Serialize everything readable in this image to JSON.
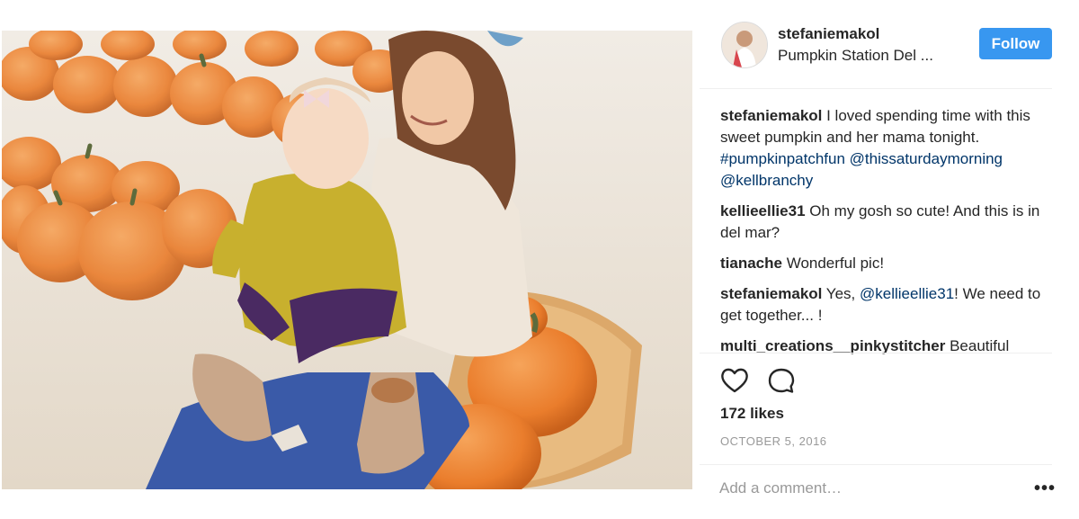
{
  "post": {
    "username": "stefaniemakol",
    "location": "Pumpkin Station Del ...",
    "follow_label": "Follow",
    "accent_color": "#3897f0",
    "photo_description_icon": "photo"
  },
  "comments": [
    {
      "user": "stefaniemakol",
      "parts": [
        {
          "text": " I loved spending time with this sweet pumpkin and her mama tonight. ",
          "link": false
        },
        {
          "text": "#pumpkinpatchfun",
          "link": true
        },
        {
          "text": " ",
          "link": false
        },
        {
          "text": "@thissaturdaymorning",
          "link": true
        },
        {
          "text": " ",
          "link": false
        },
        {
          "text": "@kellbranchy",
          "link": true
        }
      ]
    },
    {
      "user": "kellieellie31",
      "parts": [
        {
          "text": " Oh my gosh so cute! And this is in del mar?",
          "link": false
        }
      ]
    },
    {
      "user": "tianache",
      "parts": [
        {
          "text": " Wonderful pic!",
          "link": false
        }
      ]
    },
    {
      "user": "stefaniemakol",
      "parts": [
        {
          "text": " Yes, ",
          "link": false
        },
        {
          "text": "@kellieellie31",
          "link": true
        },
        {
          "text": "! We need to get together... !",
          "link": false
        }
      ]
    },
    {
      "user": "multi_creations__pinkystitcher",
      "parts": [
        {
          "text": " Beautiful",
          "link": false
        }
      ]
    }
  ],
  "stats": {
    "likes": "172 likes",
    "date": "OCTOBER 5, 2016"
  },
  "composer": {
    "placeholder": "Add a comment…",
    "more_label": "•••"
  },
  "icons": {
    "like": "heart-icon",
    "comment": "comment-bubble-icon"
  }
}
